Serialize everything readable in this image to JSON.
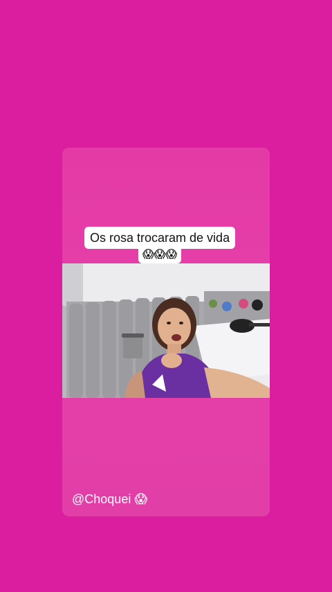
{
  "story": {
    "caption_line1": "Os rosa trocaram de vida",
    "caption_line2": "😱😱😱",
    "mention": "@Choquei 😱"
  },
  "colors": {
    "background": "#db1d9f",
    "card": "#e43aa6",
    "caption_bg": "#ffffff",
    "shirt": "#6a2fa0"
  },
  "video": {
    "scene": "woman in purple shirt recording selfie video in a bedroom"
  }
}
